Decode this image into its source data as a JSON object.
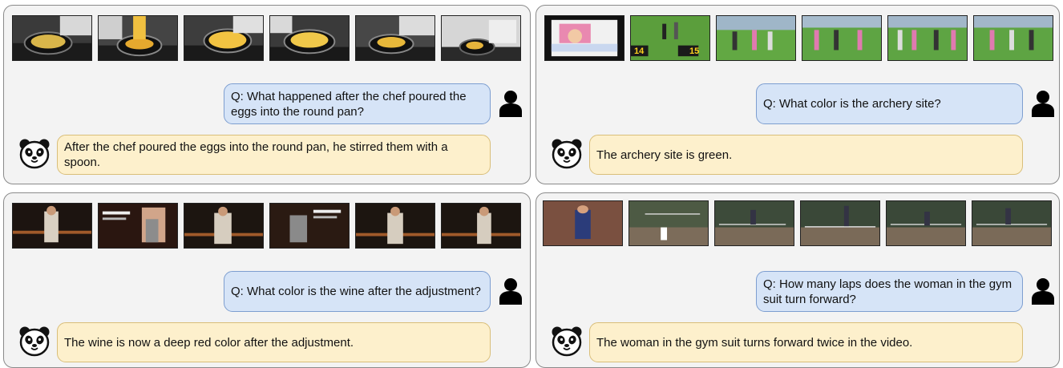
{
  "panels": [
    {
      "question": "Q: What happened after the chef poured the eggs into the round pan?",
      "answer": "After the chef poured the eggs into the round pan, he stirred them with a spoon."
    },
    {
      "question": "Q: What color is the archery site?",
      "answer": "The archery site is green."
    },
    {
      "question": "Q: What color is the wine after the adjustment?",
      "answer": "The wine is now a deep red color after the adjustment."
    },
    {
      "question": "Q: How many laps does the woman in the gym suit turn forward?",
      "answer": "The woman in the gym suit turns forward twice in the video."
    }
  ],
  "overlays": {
    "score_left": "14",
    "score_right": "15"
  },
  "colors": {
    "question_bg": "#d6e4f7",
    "answer_bg": "#fdf0cc",
    "panel_bg": "#f3f3f3"
  },
  "icons": {
    "user": "user-icon",
    "assistant": "panda-icon"
  }
}
